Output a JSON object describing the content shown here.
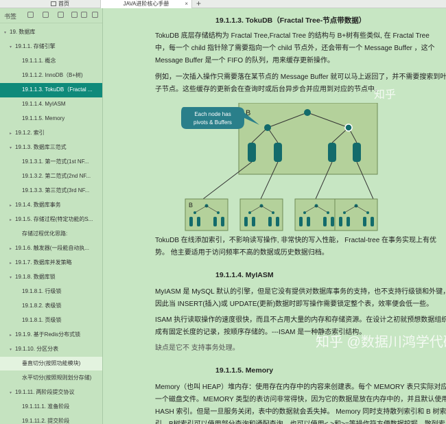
{
  "topbar": {
    "tabs": [
      {
        "label": "首页"
      },
      {
        "label": "JAVA进阶核心手册"
      }
    ],
    "close": "×",
    "add": "+"
  },
  "sidebar": {
    "title": "书签",
    "items": [
      {
        "arrow": "▾",
        "label": "19. 数据库"
      },
      {
        "arrow": "▾",
        "label": "19.1.1. 存储引擎"
      },
      {
        "arrow": "",
        "label": "19.1.1.1. 概念"
      },
      {
        "arrow": "",
        "label": "19.1.1.2. InnoDB（B+树)"
      },
      {
        "arrow": "",
        "label": "19.1.1.3. TokuDB（Fractal ..."
      },
      {
        "arrow": "",
        "label": "19.1.1.4. MyIASM"
      },
      {
        "arrow": "",
        "label": "19.1.1.5. Memory"
      },
      {
        "arrow": "▸",
        "label": "19.1.2. 索引"
      },
      {
        "arrow": "▾",
        "label": "19.1.3. 数据库三范式"
      },
      {
        "arrow": "",
        "label": "19.1.3.1. 第一范式(1st NF..."
      },
      {
        "arrow": "",
        "label": "19.1.3.2. 第二范式(2nd NF..."
      },
      {
        "arrow": "",
        "label": "19.1.3.3. 第三范式(3rd NF..."
      },
      {
        "arrow": "▸",
        "label": "19.1.4. 数据库事务"
      },
      {
        "arrow": "▸",
        "label": "19.1.5. 存储过程(特定功能的S..."
      },
      {
        "arrow": "",
        "label": "存储过程优化思路:"
      },
      {
        "arrow": "▸",
        "label": "19.1.6. 触发器(一段能自动执..."
      },
      {
        "arrow": "▸",
        "label": "19.1.7. 数据库并发策略"
      },
      {
        "arrow": "▾",
        "label": "19.1.8. 数据库锁"
      },
      {
        "arrow": "",
        "label": "19.1.8.1. 行级锁"
      },
      {
        "arrow": "",
        "label": "19.1.8.2. 表级锁"
      },
      {
        "arrow": "",
        "label": "19.1.8.1. 页级锁"
      },
      {
        "arrow": "▸",
        "label": "19.1.9. 基于Redis分布式锁"
      },
      {
        "arrow": "▾",
        "label": "19.1.10. 分区分表"
      },
      {
        "arrow": "",
        "label": "垂直切分(按照功能模块)"
      },
      {
        "arrow": "",
        "label": "水平切分(按照规则划分存储)"
      },
      {
        "arrow": "▾",
        "label": "19.1.11. 两阶段提交协议"
      },
      {
        "arrow": "",
        "label": "19.1.11.1. 准备阶段"
      },
      {
        "arrow": "",
        "label": "19.1.11.2. 提交阶段"
      }
    ]
  },
  "content": {
    "heading1": "19.1.1.3.   TokuDB（Fractal Tree-节点带数据）",
    "p1_l1": "TokuDB 底层存储结构为 Fractal Tree,Fractal Tree 的结构与 B+树有些类似, 在 Fractal Tree",
    "p1_l2": "中，每一个 child 指针除了需要指向一个 child 节点外，还会带有一个 Message Buffer ，这个",
    "p1_l3": "Message Buffer 是一个 FIFO 的队列，用来缓存更新操作。",
    "p2_l1": "例如，一次插入操作只需要落在某节点的 Message Buffer 就可以马上返回了，并不需要搜索到叶",
    "p2_l2": "子节点。这些缓存的更新会在查询时或后台异步合并应用到对应的节点中。",
    "callout": [
      "Each node has",
      "pivots & Buffers"
    ],
    "node_label": "B",
    "leaf_label": "B",
    "p3_l1": "TokuDB 在线添加索引，不影响读写操作, 非常快的写入性能， Fractal-tree 在事务实现上有优",
    "p3_l2": "势。 他主要适用于访问频率不高的数据或历史数据归档。",
    "heading2": "19.1.1.4.    MyIASM",
    "p4_l1": "MyIASM 是 MySQL 默认的引擎，但是它没有提供对数据库事务的支持，也不支持行级锁和外键，",
    "p4_l2": "因此当 INSERT(插入)或 UPDATE(更新)数据时即写操作需要锁定整个表，效率便会低一些。",
    "p5_l1": "ISAM 执行读取操作的速度很快，而且不占用大量的内存和存储资源。在设计之初就预想数据组织",
    "p5_l2": "成有固定长度的记录，按顺序存储的。---ISAM 是一种静态索引结构。",
    "p6": "缺点是它不 支持事务处理。",
    "heading3": "19.1.1.5.    Memory",
    "p7_l1": "Memory（也叫 HEAP）堆内存：使用存在内存中的内容来创建表。每个 MEMORY 表只实际对应",
    "p7_l2": "一个磁盘文件。MEMORY 类型的表访问非常得快，因为它的数据是放在内存中的，并且默认使用",
    "p7_l3": "HASH 索引。但是一旦服务关闭，表中的数据就会丢失掉。 Memory 同时支持散列索引和 B 树索",
    "p7_l4": "引，B树索引可以使用部分查询和通配查询，也可以使用<,>和>=等操作符方便数据挖掘，散列索"
  },
  "watermark": "知乎 @数据川鸿学代码",
  "watermark_top": "知乎",
  "colors": {
    "active": "#0f8a7a",
    "background": "#c7e6c3",
    "panel": "#b4d19b",
    "node": "#136b6b",
    "callout": "#2a7f8a"
  }
}
